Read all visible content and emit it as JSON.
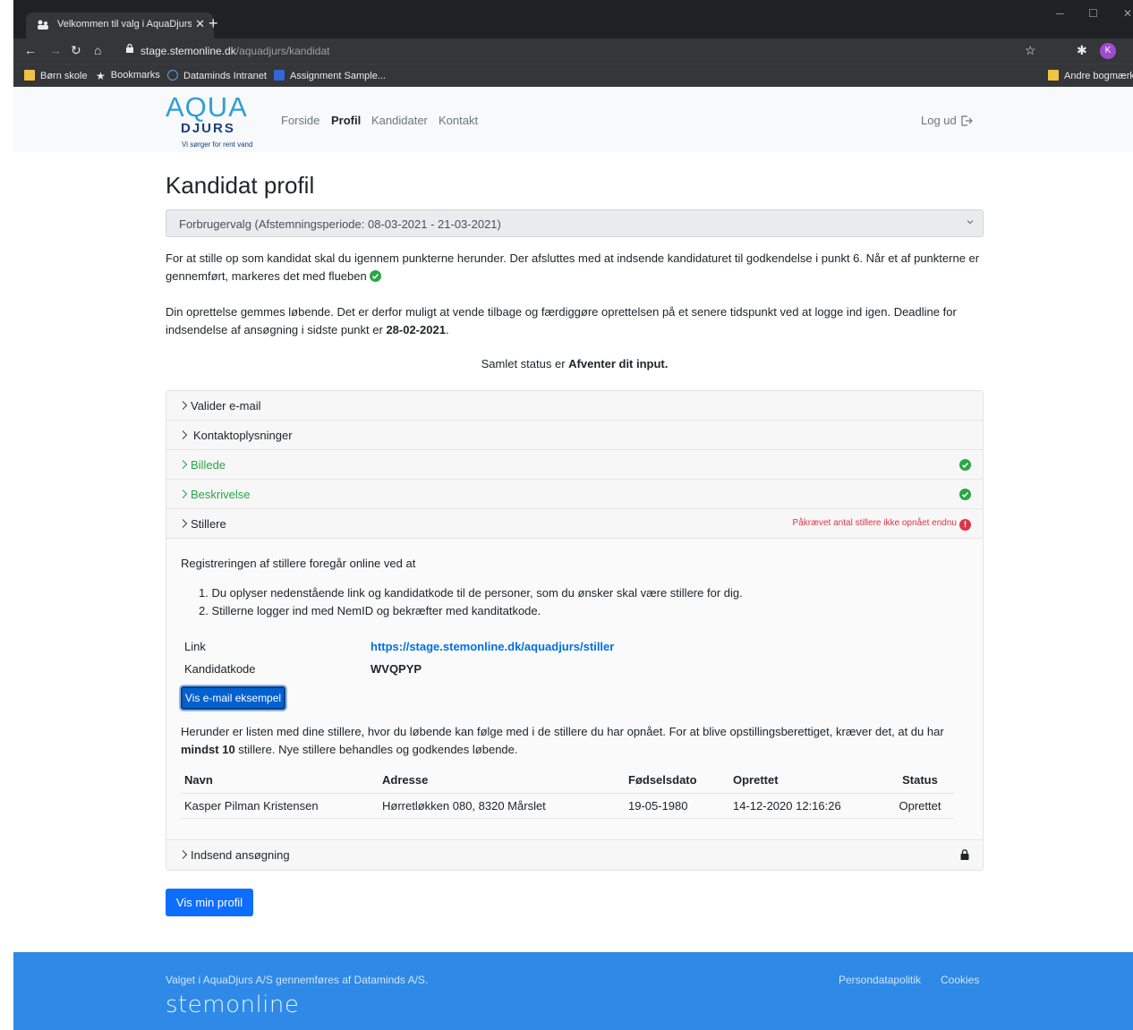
{
  "browser": {
    "tab_title": "Velkommen til valg i AquaDjurs /",
    "tab_close": "✕",
    "new_tab": "+",
    "url_host": "stage.stemonline.dk",
    "url_path": "/aquadjurs/kandidat",
    "avatar_letter": "K",
    "bookmarks": [
      "Børn skole",
      "Bookmarks",
      "Dataminds Intranet",
      "Assignment Sample...",
      "Andre bogmærke"
    ]
  },
  "nav": {
    "logo_main": "AQUA",
    "logo_sub": "DJURS",
    "logo_tagline": "Vi sørger for rent vand",
    "links": [
      "Forside",
      "Profil",
      "Kandidater",
      "Kontakt"
    ],
    "logout": "Log ud"
  },
  "page": {
    "title": "Kandidat profil",
    "select_value": "Forbrugervalg (Afstemningsperiode: 08-03-2021 - 21-03-2021)",
    "intro_1": "For at stille op som kandidat skal du igennem punkterne herunder. Der afsluttes med at indsende kandidaturet til godkendelse i punkt 6. Når et af punkterne er gennemført, markeres det med flueben",
    "intro_2a": "Din oprettelse gemmes løbende. Det er derfor muligt at vende tilbage og færdiggøre oprettelsen på et senere tidspunkt ved at logge ind igen. Deadline for indsendelse af ansøgning i sidste punkt er ",
    "intro_2_deadline": "28-02-2021",
    "intro_2_end": ".",
    "status_prefix": "Samlet status er ",
    "status_value": "Afventer dit input."
  },
  "accordion": {
    "items": [
      {
        "label": "Valider e-mail",
        "state": "default"
      },
      {
        "label": "Kontaktoplysninger",
        "state": "default"
      },
      {
        "label": "Billede",
        "state": "done"
      },
      {
        "label": "Beskrivelse",
        "state": "done"
      },
      {
        "label": "Stillere",
        "state": "warning",
        "warning": "Påkrævet antal stillere ikke opnået endnu",
        "warning_icon": "!"
      },
      {
        "label": "Indsend ansøgning",
        "state": "locked"
      }
    ],
    "stillere_body": {
      "intro": "Registreringen af stillere foregår online ved at",
      "steps": [
        "1. Du oplyser nedenstående link og kandidatkode til de personer, som du ønsker skal være stillere for dig.",
        "2. Stillerne logger ind med NemID og bekræfter med kanditatkode."
      ],
      "link_label": "Link",
      "link_value": "https://stage.stemonline.dk/aquadjurs/stiller",
      "code_label": "Kandidatkode",
      "code_value": "WVQPYP",
      "email_button": "Vis e-mail eksempel",
      "para_a": "Herunder er listen med dine stillere, hvor du løbende kan følge med i de stillere du har opnået. For at blive opstillingsberettiget, kræver det, at du har ",
      "para_bold": "mindst 10",
      "para_b": " stillere. Nye stillere behandles og godkendes løbende.",
      "table": {
        "headers": [
          "Navn",
          "Adresse",
          "Fødselsdato",
          "Oprettet",
          "Status"
        ],
        "rows": [
          [
            "Kasper Pilman Kristensen",
            "Hørretløkken 080, 8320 Mårslet",
            "19-05-1980",
            "14-12-2020 12:16:26",
            "Oprettet"
          ]
        ]
      }
    }
  },
  "profile_button": "Vis min profil",
  "footer": {
    "text": "Valget i AquaDjurs A/S gennemføres af Dataminds A/S.",
    "logo": "stemonline",
    "links": [
      "Persondatapolitik",
      "Cookies"
    ]
  },
  "colors": {
    "primary": "#0d6efd",
    "success": "#28a745",
    "danger": "#dc3545",
    "footer": "#2e8ae6"
  }
}
